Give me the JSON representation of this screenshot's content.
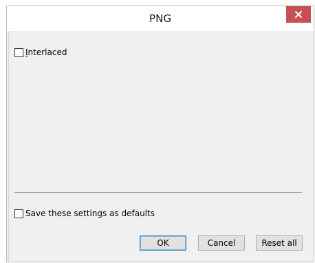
{
  "window": {
    "title": "PNG"
  },
  "options": {
    "interlaced_first": "I",
    "interlaced_rest": "nterlaced",
    "interlaced_checked": false
  },
  "footer": {
    "save_defaults_label": "Save these settings as defaults",
    "save_defaults_checked": false
  },
  "buttons": {
    "ok": "OK",
    "cancel": "Cancel",
    "reset_all": "Reset all"
  },
  "colors": {
    "close_button": "#c75050",
    "dialog_background": "#f0f0f0",
    "default_button_border": "#3c7fb1"
  },
  "icons": {
    "close": "close-icon"
  }
}
